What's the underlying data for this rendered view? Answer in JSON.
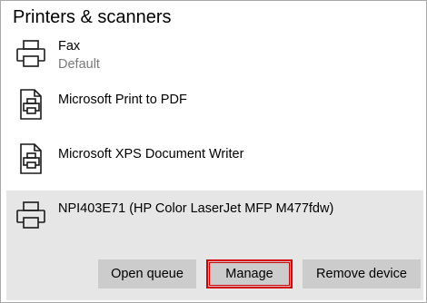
{
  "section": {
    "title": "Printers & scanners"
  },
  "printers": [
    {
      "name": "Fax",
      "status": "Default",
      "icon": "printer-icon"
    },
    {
      "name": "Microsoft Print to PDF",
      "icon": "document-printer-icon"
    },
    {
      "name": "Microsoft XPS Document Writer",
      "icon": "document-printer-icon"
    },
    {
      "name": "NPI403E71 (HP Color LaserJet MFP M477fdw)",
      "icon": "printer-icon",
      "selected": true
    }
  ],
  "actions": {
    "open_queue": "Open queue",
    "manage": "Manage",
    "remove_device": "Remove device"
  },
  "colors": {
    "selected_background": "#e6e6e6",
    "button_background": "#cccccc",
    "highlight_border": "#d60000",
    "secondary_text": "#7a7a7a"
  }
}
